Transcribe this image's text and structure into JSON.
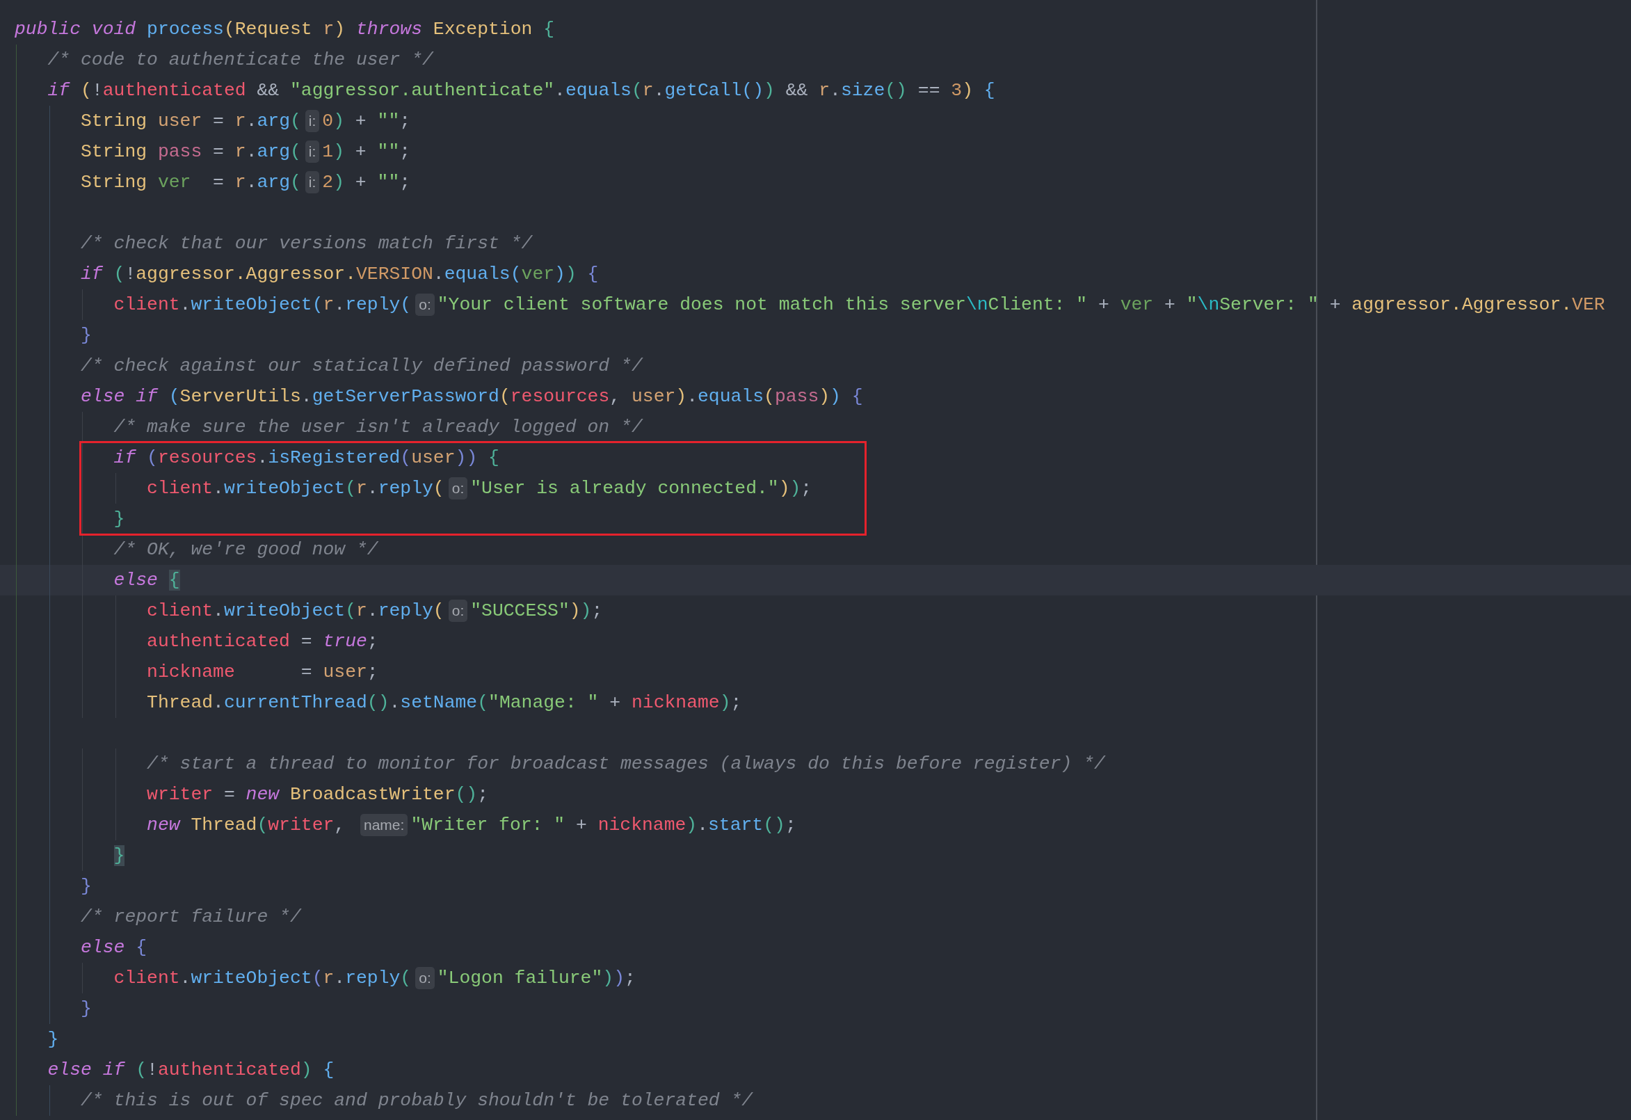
{
  "lines": [
    {
      "tokens": [
        {
          "kind": "kw",
          "text": "public void "
        },
        {
          "kind": "fn",
          "text": "process"
        },
        {
          "kind": "py",
          "text": "("
        },
        {
          "kind": "type",
          "text": "Request "
        },
        {
          "kind": "varA",
          "text": "r"
        },
        {
          "kind": "py",
          "text": ")"
        },
        {
          "kind": "kw",
          "text": " throws "
        },
        {
          "kind": "type",
          "text": "Exception "
        },
        {
          "kind": "pg",
          "text": "{"
        }
      ]
    },
    {
      "tokens": [
        {
          "kind": "cmt",
          "text": "   /* code to authenticate the user */"
        }
      ]
    },
    {
      "tokens": [
        {
          "kind": "kw",
          "text": "   if "
        },
        {
          "kind": "py",
          "text": "("
        },
        {
          "kind": "txt",
          "text": "!"
        },
        {
          "kind": "field",
          "text": "authenticated"
        },
        {
          "kind": "txt",
          "text": " && "
        },
        {
          "kind": "str",
          "text": "\"aggressor.authenticate\""
        },
        {
          "kind": "txt",
          "text": "."
        },
        {
          "kind": "fn",
          "text": "equals"
        },
        {
          "kind": "pg",
          "text": "("
        },
        {
          "kind": "varA",
          "text": "r"
        },
        {
          "kind": "txt",
          "text": "."
        },
        {
          "kind": "fn",
          "text": "getCall"
        },
        {
          "kind": "pb",
          "text": "()"
        },
        {
          "kind": "pg",
          "text": ")"
        },
        {
          "kind": "txt",
          "text": " && "
        },
        {
          "kind": "varA",
          "text": "r"
        },
        {
          "kind": "txt",
          "text": "."
        },
        {
          "kind": "fn",
          "text": "size"
        },
        {
          "kind": "pg",
          "text": "()"
        },
        {
          "kind": "txt",
          "text": " == "
        },
        {
          "kind": "num",
          "text": "3"
        },
        {
          "kind": "py",
          "text": ")"
        },
        {
          "kind": "pb",
          "text": " {"
        }
      ]
    },
    {
      "tokens": [
        {
          "kind": "type",
          "text": "      String "
        },
        {
          "kind": "varA",
          "text": "user"
        },
        {
          "kind": "txt",
          "text": " = "
        },
        {
          "kind": "varA",
          "text": "r"
        },
        {
          "kind": "txt",
          "text": "."
        },
        {
          "kind": "fn",
          "text": "arg"
        },
        {
          "kind": "pg",
          "text": "("
        },
        {
          "kind": "hint",
          "text": "i:"
        },
        {
          "kind": "num",
          "text": "0"
        },
        {
          "kind": "pg",
          "text": ")"
        },
        {
          "kind": "txt",
          "text": " + "
        },
        {
          "kind": "str",
          "text": "\"\""
        },
        {
          "kind": "txt",
          "text": ";"
        }
      ]
    },
    {
      "tokens": [
        {
          "kind": "type",
          "text": "      String "
        },
        {
          "kind": "varB",
          "text": "pass"
        },
        {
          "kind": "txt",
          "text": " = "
        },
        {
          "kind": "varA",
          "text": "r"
        },
        {
          "kind": "txt",
          "text": "."
        },
        {
          "kind": "fn",
          "text": "arg"
        },
        {
          "kind": "pg",
          "text": "("
        },
        {
          "kind": "hint",
          "text": "i:"
        },
        {
          "kind": "num",
          "text": "1"
        },
        {
          "kind": "pg",
          "text": ")"
        },
        {
          "kind": "txt",
          "text": " + "
        },
        {
          "kind": "str",
          "text": "\"\""
        },
        {
          "kind": "txt",
          "text": ";"
        }
      ]
    },
    {
      "tokens": [
        {
          "kind": "type",
          "text": "      String "
        },
        {
          "kind": "varC",
          "text": "ver"
        },
        {
          "kind": "txt",
          "text": "  = "
        },
        {
          "kind": "varA",
          "text": "r"
        },
        {
          "kind": "txt",
          "text": "."
        },
        {
          "kind": "fn",
          "text": "arg"
        },
        {
          "kind": "pg",
          "text": "("
        },
        {
          "kind": "hint",
          "text": "i:"
        },
        {
          "kind": "num",
          "text": "2"
        },
        {
          "kind": "pg",
          "text": ")"
        },
        {
          "kind": "txt",
          "text": " + "
        },
        {
          "kind": "str",
          "text": "\"\""
        },
        {
          "kind": "txt",
          "text": ";"
        }
      ]
    },
    {
      "kind": "blank"
    },
    {
      "tokens": [
        {
          "kind": "cmt",
          "text": "      /* check that our versions match first */"
        }
      ]
    },
    {
      "tokens": [
        {
          "kind": "kw",
          "text": "      if "
        },
        {
          "kind": "pg",
          "text": "("
        },
        {
          "kind": "txt",
          "text": "!"
        },
        {
          "kind": "type",
          "text": "aggressor.Aggressor."
        },
        {
          "kind": "const",
          "text": "VERSION"
        },
        {
          "kind": "txt",
          "text": "."
        },
        {
          "kind": "fn",
          "text": "equals"
        },
        {
          "kind": "pb",
          "text": "("
        },
        {
          "kind": "varC",
          "text": "ver"
        },
        {
          "kind": "pb",
          "text": ")"
        },
        {
          "kind": "pg",
          "text": ")"
        },
        {
          "kind": "pv",
          "text": " {"
        }
      ]
    },
    {
      "tokens": [
        {
          "kind": "field",
          "text": "         client"
        },
        {
          "kind": "txt",
          "text": "."
        },
        {
          "kind": "fn",
          "text": "writeObject"
        },
        {
          "kind": "pb",
          "text": "("
        },
        {
          "kind": "varA",
          "text": "r"
        },
        {
          "kind": "txt",
          "text": "."
        },
        {
          "kind": "fn",
          "text": "reply"
        },
        {
          "kind": "pb",
          "text": "("
        },
        {
          "kind": "hint",
          "text": "o:"
        },
        {
          "kind": "str",
          "text": "\"Your client software does not match this server"
        },
        {
          "kind": "esc",
          "text": "\\n"
        },
        {
          "kind": "str",
          "text": "Client: \""
        },
        {
          "kind": "txt",
          "text": " + "
        },
        {
          "kind": "varC",
          "text": "ver"
        },
        {
          "kind": "txt",
          "text": " + "
        },
        {
          "kind": "str",
          "text": "\""
        },
        {
          "kind": "esc",
          "text": "\\n"
        },
        {
          "kind": "str",
          "text": "Server: \""
        },
        {
          "kind": "txt",
          "text": " + "
        },
        {
          "kind": "type",
          "text": "aggressor.Aggressor."
        },
        {
          "kind": "const",
          "text": "VER"
        }
      ]
    },
    {
      "tokens": [
        {
          "kind": "pv",
          "text": "      }"
        }
      ]
    },
    {
      "tokens": [
        {
          "kind": "cmt",
          "text": "      /* check against our statically defined password */"
        }
      ]
    },
    {
      "tokens": [
        {
          "kind": "kw",
          "text": "      else if "
        },
        {
          "kind": "pb",
          "text": "("
        },
        {
          "kind": "type",
          "text": "ServerUtils"
        },
        {
          "kind": "txt",
          "text": "."
        },
        {
          "kind": "fn",
          "text": "getServerPassword"
        },
        {
          "kind": "py",
          "text": "("
        },
        {
          "kind": "field",
          "text": "resources"
        },
        {
          "kind": "txt",
          "text": ", "
        },
        {
          "kind": "varA",
          "text": "user"
        },
        {
          "kind": "py",
          "text": ")"
        },
        {
          "kind": "txt",
          "text": "."
        },
        {
          "kind": "fn",
          "text": "equals"
        },
        {
          "kind": "py",
          "text": "("
        },
        {
          "kind": "varB",
          "text": "pass"
        },
        {
          "kind": "py",
          "text": ")"
        },
        {
          "kind": "pb",
          "text": ")"
        },
        {
          "kind": "pv",
          "text": " {"
        }
      ]
    },
    {
      "tokens": [
        {
          "kind": "cmt",
          "text": "         /* make sure the user isn't already logged on */"
        }
      ]
    },
    {
      "boxed": true,
      "tokens": [
        {
          "kind": "kw",
          "text": "         if "
        },
        {
          "kind": "pv",
          "text": "("
        },
        {
          "kind": "field",
          "text": "resources"
        },
        {
          "kind": "txt",
          "text": "."
        },
        {
          "kind": "fn",
          "text": "isRegistered"
        },
        {
          "kind": "pv",
          "text": "("
        },
        {
          "kind": "varA",
          "text": "user"
        },
        {
          "kind": "pv",
          "text": "))"
        },
        {
          "kind": "pg",
          "text": " {"
        }
      ]
    },
    {
      "boxed": true,
      "tokens": [
        {
          "kind": "field",
          "text": "            client"
        },
        {
          "kind": "txt",
          "text": "."
        },
        {
          "kind": "fn",
          "text": "writeObject"
        },
        {
          "kind": "pg",
          "text": "("
        },
        {
          "kind": "varA",
          "text": "r"
        },
        {
          "kind": "txt",
          "text": "."
        },
        {
          "kind": "fn",
          "text": "reply"
        },
        {
          "kind": "py",
          "text": "("
        },
        {
          "kind": "hint",
          "text": "o:"
        },
        {
          "kind": "str",
          "text": "\"User is already connected.\""
        },
        {
          "kind": "py",
          "text": ")"
        },
        {
          "kind": "pg",
          "text": ")"
        },
        {
          "kind": "txt",
          "text": ";"
        }
      ]
    },
    {
      "boxed": true,
      "tokens": [
        {
          "kind": "pg",
          "text": "         }"
        }
      ]
    },
    {
      "tokens": [
        {
          "kind": "cmt",
          "text": "         /* OK, we're good now */"
        }
      ]
    },
    {
      "current": true,
      "tokens": [
        {
          "kind": "kw",
          "text": "         else "
        },
        {
          "kind": "match",
          "text": "{"
        }
      ]
    },
    {
      "tokens": [
        {
          "kind": "field",
          "text": "            client"
        },
        {
          "kind": "txt",
          "text": "."
        },
        {
          "kind": "fn",
          "text": "writeObject"
        },
        {
          "kind": "pg",
          "text": "("
        },
        {
          "kind": "varA",
          "text": "r"
        },
        {
          "kind": "txt",
          "text": "."
        },
        {
          "kind": "fn",
          "text": "reply"
        },
        {
          "kind": "py",
          "text": "("
        },
        {
          "kind": "hint",
          "text": "o:"
        },
        {
          "kind": "str",
          "text": "\"SUCCESS\""
        },
        {
          "kind": "py",
          "text": ")"
        },
        {
          "kind": "pg",
          "text": ")"
        },
        {
          "kind": "txt",
          "text": ";"
        }
      ]
    },
    {
      "tokens": [
        {
          "kind": "field",
          "text": "            authenticated"
        },
        {
          "kind": "txt",
          "text": " = "
        },
        {
          "kind": "kw",
          "text": "true"
        },
        {
          "kind": "txt",
          "text": ";"
        }
      ]
    },
    {
      "tokens": [
        {
          "kind": "field",
          "text": "            nickname"
        },
        {
          "kind": "txt",
          "text": "      = "
        },
        {
          "kind": "varA",
          "text": "user"
        },
        {
          "kind": "txt",
          "text": ";"
        }
      ]
    },
    {
      "tokens": [
        {
          "kind": "type",
          "text": "            Thread"
        },
        {
          "kind": "txt",
          "text": "."
        },
        {
          "kind": "fn",
          "text": "currentThread"
        },
        {
          "kind": "pg",
          "text": "()"
        },
        {
          "kind": "txt",
          "text": "."
        },
        {
          "kind": "fn",
          "text": "setName"
        },
        {
          "kind": "pg",
          "text": "("
        },
        {
          "kind": "str",
          "text": "\"Manage: \""
        },
        {
          "kind": "txt",
          "text": " + "
        },
        {
          "kind": "field",
          "text": "nickname"
        },
        {
          "kind": "pg",
          "text": ")"
        },
        {
          "kind": "txt",
          "text": ";"
        }
      ]
    },
    {
      "kind": "blank"
    },
    {
      "tokens": [
        {
          "kind": "cmt",
          "text": "            /* start a thread to monitor for broadcast messages (always do this before register) */"
        }
      ]
    },
    {
      "tokens": [
        {
          "kind": "field",
          "text": "            writer"
        },
        {
          "kind": "txt",
          "text": " = "
        },
        {
          "kind": "kw",
          "text": "new "
        },
        {
          "kind": "type",
          "text": "BroadcastWriter"
        },
        {
          "kind": "pg",
          "text": "()"
        },
        {
          "kind": "txt",
          "text": ";"
        }
      ]
    },
    {
      "tokens": [
        {
          "kind": "kw",
          "text": "            new "
        },
        {
          "kind": "type",
          "text": "Thread"
        },
        {
          "kind": "pg",
          "text": "("
        },
        {
          "kind": "field",
          "text": "writer"
        },
        {
          "kind": "txt",
          "text": ", "
        },
        {
          "kind": "hint",
          "text": "name:"
        },
        {
          "kind": "str",
          "text": "\"Writer for: \""
        },
        {
          "kind": "txt",
          "text": " + "
        },
        {
          "kind": "field",
          "text": "nickname"
        },
        {
          "kind": "pg",
          "text": ")"
        },
        {
          "kind": "txt",
          "text": "."
        },
        {
          "kind": "fn",
          "text": "start"
        },
        {
          "kind": "pg",
          "text": "()"
        },
        {
          "kind": "txt",
          "text": ";"
        }
      ]
    },
    {
      "tokens": [
        {
          "kind": "match",
          "text": "         }"
        }
      ]
    },
    {
      "tokens": [
        {
          "kind": "pv",
          "text": "      }"
        }
      ]
    },
    {
      "tokens": [
        {
          "kind": "cmt",
          "text": "      /* report failure */"
        }
      ]
    },
    {
      "tokens": [
        {
          "kind": "kw",
          "text": "      else "
        },
        {
          "kind": "pv",
          "text": "{"
        }
      ]
    },
    {
      "tokens": [
        {
          "kind": "field",
          "text": "         client"
        },
        {
          "kind": "txt",
          "text": "."
        },
        {
          "kind": "fn",
          "text": "writeObject"
        },
        {
          "kind": "pv",
          "text": "("
        },
        {
          "kind": "varA",
          "text": "r"
        },
        {
          "kind": "txt",
          "text": "."
        },
        {
          "kind": "fn",
          "text": "reply"
        },
        {
          "kind": "pg",
          "text": "("
        },
        {
          "kind": "hint",
          "text": "o:"
        },
        {
          "kind": "str",
          "text": "\"Logon failure\""
        },
        {
          "kind": "pg",
          "text": ")"
        },
        {
          "kind": "pv",
          "text": ")"
        },
        {
          "kind": "txt",
          "text": ";"
        }
      ]
    },
    {
      "tokens": [
        {
          "kind": "pv",
          "text": "      }"
        }
      ]
    },
    {
      "tokens": [
        {
          "kind": "pb",
          "text": "   }"
        }
      ]
    },
    {
      "tokens": [
        {
          "kind": "kw",
          "text": "   else if "
        },
        {
          "kind": "pg",
          "text": "("
        },
        {
          "kind": "txt",
          "text": "!"
        },
        {
          "kind": "field",
          "text": "authenticated"
        },
        {
          "kind": "pg",
          "text": ")"
        },
        {
          "kind": "pb",
          "text": " {"
        }
      ]
    },
    {
      "tokens": [
        {
          "kind": "cmt",
          "text": "      /* this is out of spec and probably shouldn't be tolerated */"
        }
      ]
    }
  ]
}
